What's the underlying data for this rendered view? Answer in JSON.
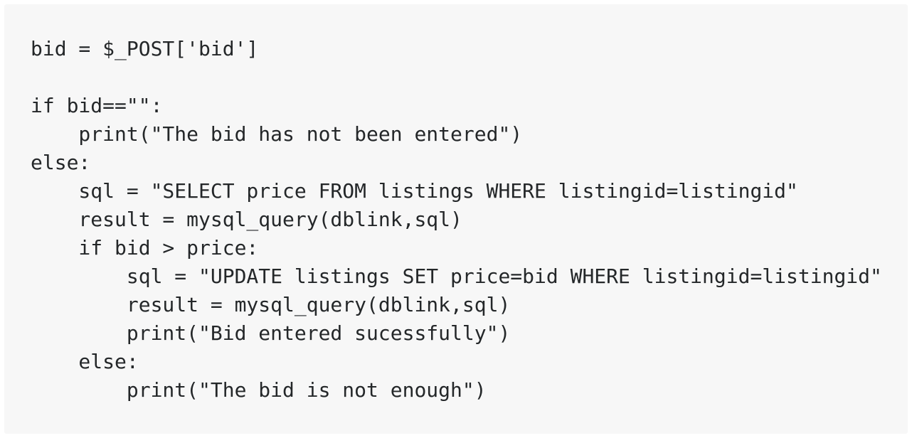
{
  "code": {
    "lines": [
      "bid = $_POST['bid']",
      "",
      "if bid==\"\":",
      "    print(\"The bid has not been entered\")",
      "else:",
      "    sql = \"SELECT price FROM listings WHERE listingid=listingid\"",
      "    result = mysql_query(dblink,sql)",
      "    if bid > price:",
      "        sql = \"UPDATE listings SET price=bid WHERE listingid=listingid\"",
      "        result = mysql_query(dblink,sql)",
      "        print(\"Bid entered sucessfully\")",
      "    else:",
      "        print(\"The bid is not enough\")"
    ]
  },
  "colors": {
    "background": "#f7f7f7",
    "text": "#242729"
  }
}
